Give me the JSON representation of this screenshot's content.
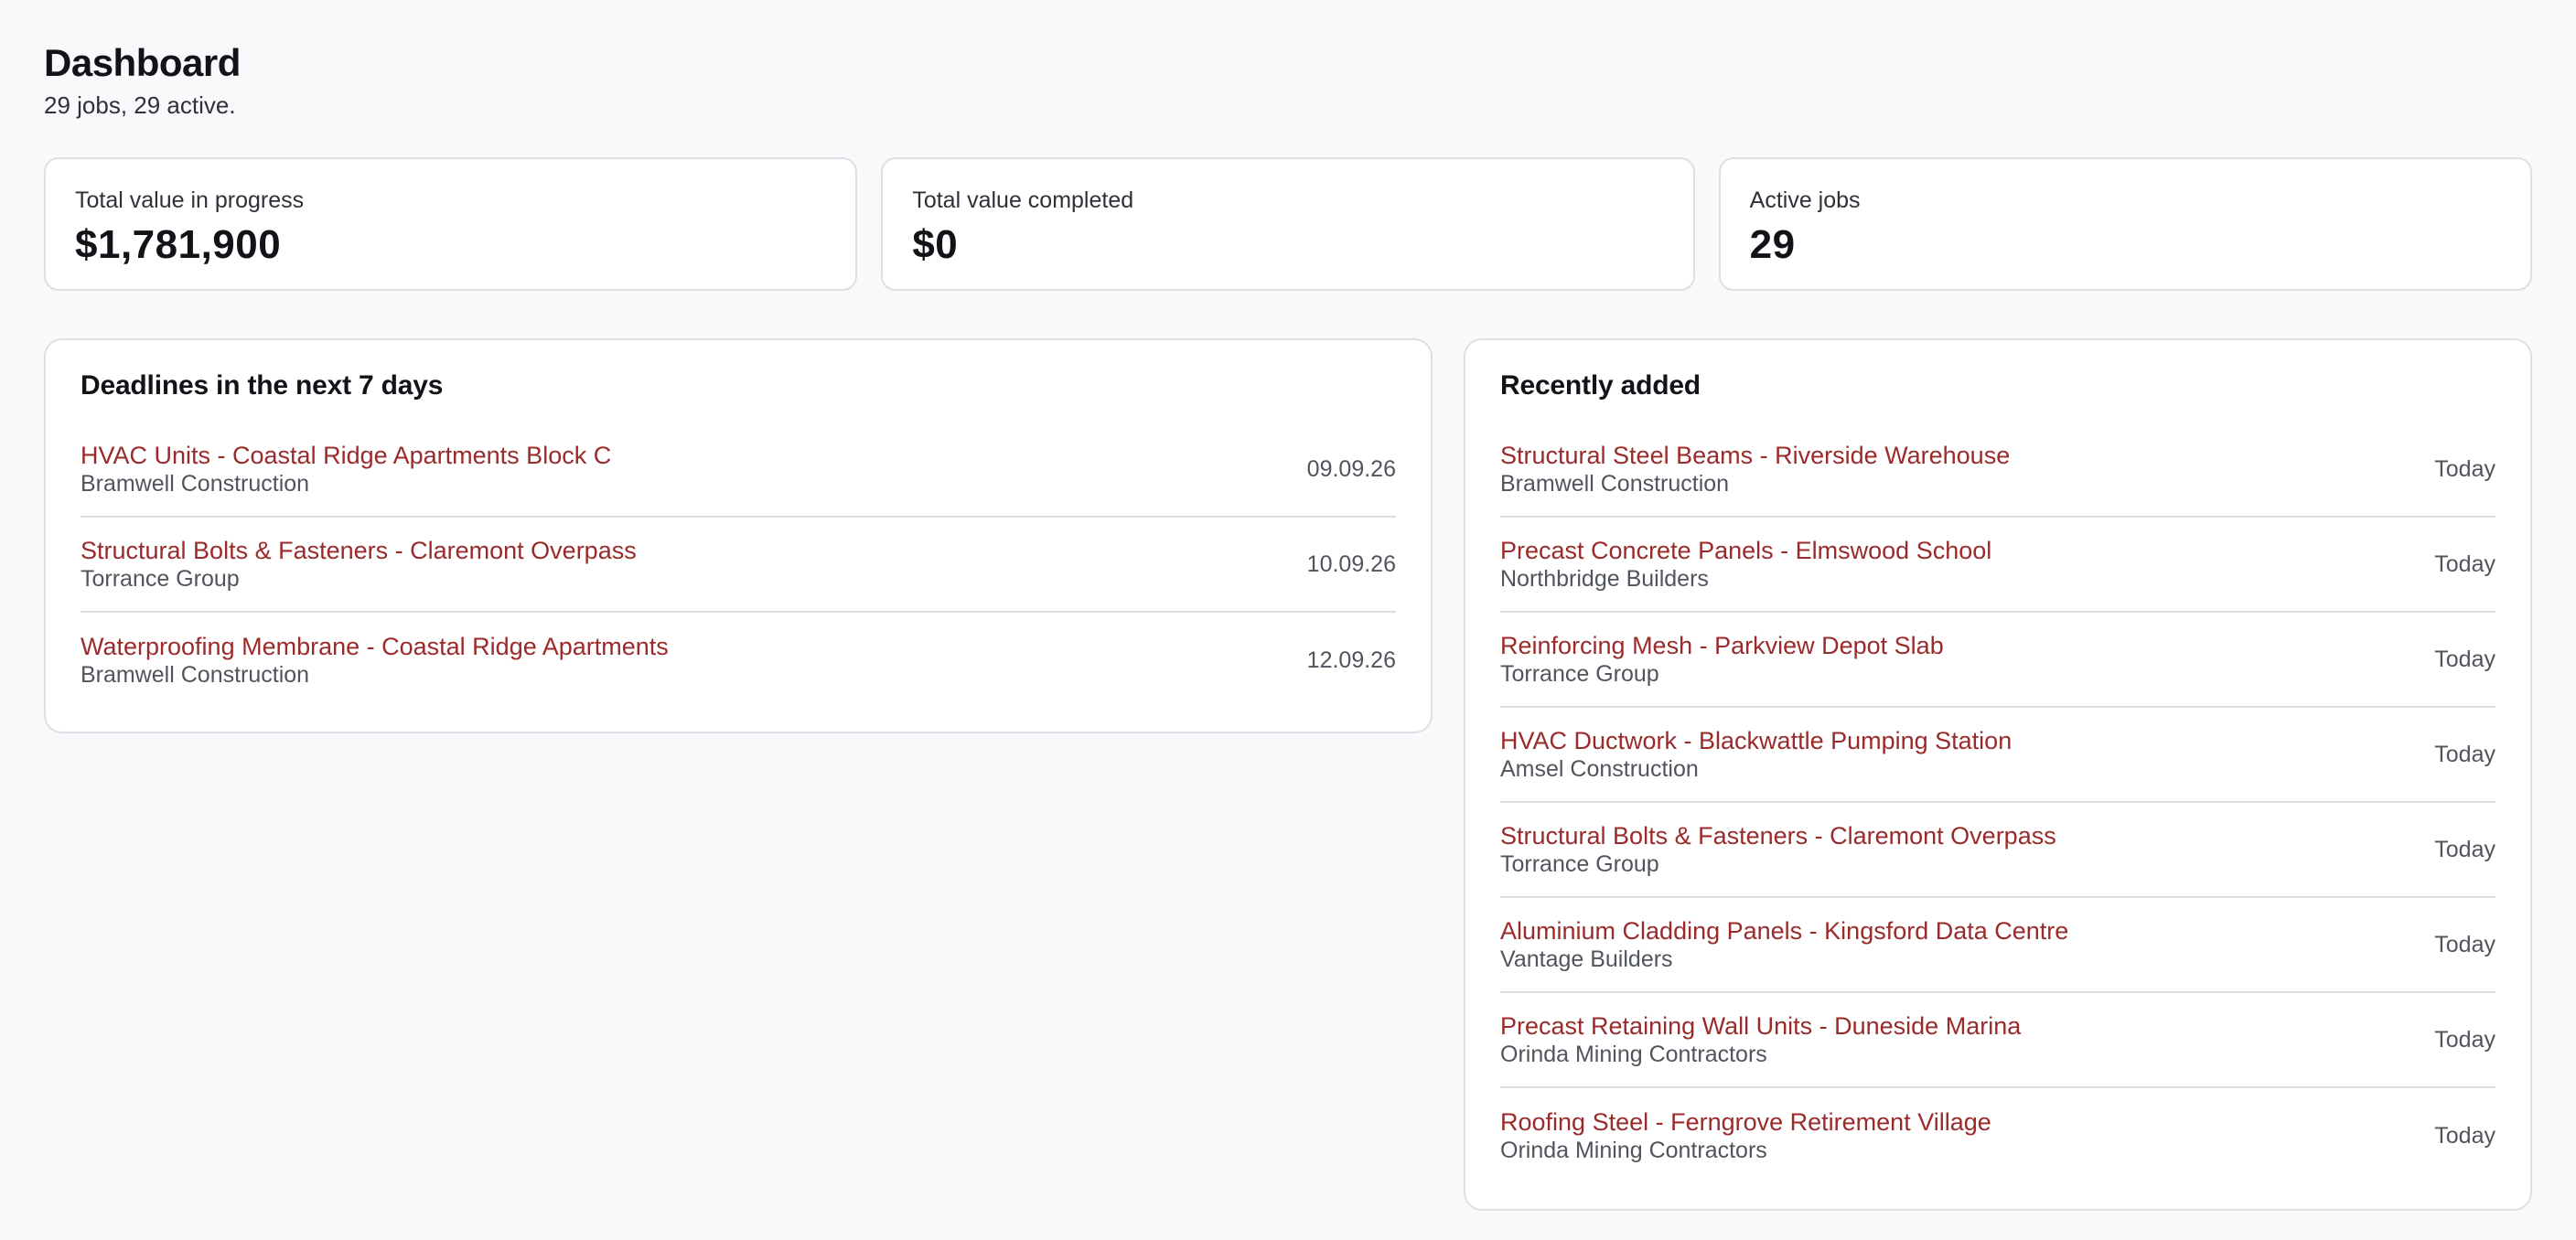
{
  "header": {
    "title": "Dashboard",
    "subtitle": "29 jobs, 29 active."
  },
  "stats": [
    {
      "label": "Total value in progress",
      "value": "$1,781,900"
    },
    {
      "label": "Total value completed",
      "value": "$0"
    },
    {
      "label": "Active jobs",
      "value": "29"
    }
  ],
  "deadlines": {
    "title": "Deadlines in the next 7 days",
    "items": [
      {
        "title": "HVAC Units - Coastal Ridge Apartments Block C",
        "client": "Bramwell Construction",
        "date": "09.09.26"
      },
      {
        "title": "Structural Bolts & Fasteners - Claremont Overpass",
        "client": "Torrance Group",
        "date": "10.09.26"
      },
      {
        "title": "Waterproofing Membrane - Coastal Ridge Apartments",
        "client": "Bramwell Construction",
        "date": "12.09.26"
      }
    ]
  },
  "recent": {
    "title": "Recently added",
    "items": [
      {
        "title": "Structural Steel Beams - Riverside Warehouse",
        "client": "Bramwell Construction",
        "date": "Today"
      },
      {
        "title": "Precast Concrete Panels - Elmswood School",
        "client": "Northbridge Builders",
        "date": "Today"
      },
      {
        "title": "Reinforcing Mesh - Parkview Depot Slab",
        "client": "Torrance Group",
        "date": "Today"
      },
      {
        "title": "HVAC Ductwork - Blackwattle Pumping Station",
        "client": "Amsel Construction",
        "date": "Today"
      },
      {
        "title": "Structural Bolts & Fasteners - Claremont Overpass",
        "client": "Torrance Group",
        "date": "Today"
      },
      {
        "title": "Aluminium Cladding Panels - Kingsford Data Centre",
        "client": "Vantage Builders",
        "date": "Today"
      },
      {
        "title": "Precast Retaining Wall Units - Duneside Marina",
        "client": "Orinda Mining Contractors",
        "date": "Today"
      },
      {
        "title": "Roofing Steel - Ferngrove Retirement Village",
        "client": "Orinda Mining Contractors",
        "date": "Today"
      }
    ]
  },
  "colors": {
    "background": "#f8f9fb",
    "link": "#9b2a2a",
    "border": "#dcdfe4"
  }
}
